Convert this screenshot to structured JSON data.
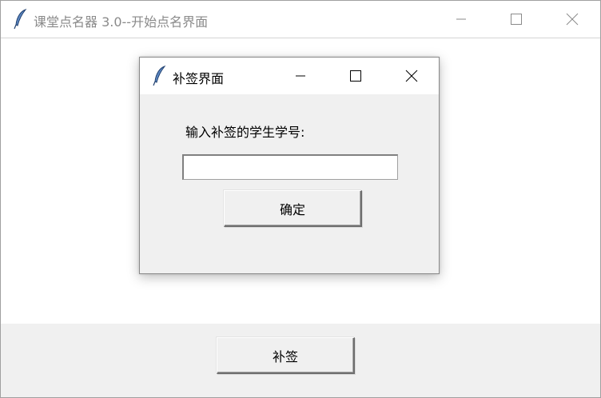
{
  "main_window": {
    "title": "课堂点名器 3.0--开始点名界面",
    "controls": [
      "minimize-icon",
      "maximize-icon",
      "close-icon"
    ]
  },
  "bottom_bar": {
    "makeup_button_label": "补签"
  },
  "dialog": {
    "title": "补签界面",
    "prompt_label": "输入补签的学生学号:",
    "student_id_value": "",
    "confirm_label": "确定"
  },
  "colors": {
    "window_bg": "#ffffff",
    "panel_bg": "#f0f0f0",
    "title_inactive": "#8a8a8a",
    "feather_blue": "#3a6fb0"
  }
}
